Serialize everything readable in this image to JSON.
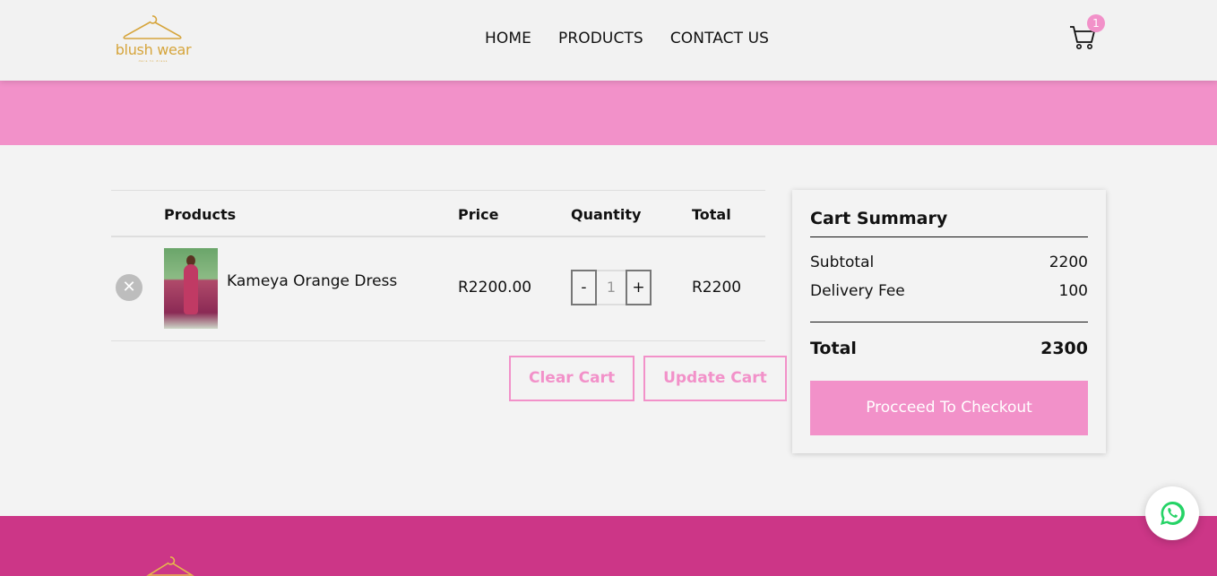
{
  "brand": {
    "logo_text": "blush wear",
    "logo_tagline": "dare to dress"
  },
  "nav": {
    "items": [
      "HOME",
      "PRODUCTS",
      "CONTACT US"
    ]
  },
  "cart": {
    "badge_count": "1"
  },
  "table": {
    "headers": {
      "products": "Products",
      "price": "Price",
      "quantity": "Quantity",
      "total": "Total"
    },
    "rows": [
      {
        "name": "Kameya Orange Dress",
        "price": "R2200.00",
        "quantity": "1",
        "total": "R2200",
        "decrement": "-",
        "increment": "+"
      }
    ]
  },
  "actions": {
    "clear": "Clear Cart",
    "update": "Update Cart"
  },
  "summary": {
    "title": "Cart Summary",
    "subtotal_label": "Subtotal",
    "subtotal_value": "2200",
    "delivery_label": "Delivery Fee",
    "delivery_value": "100",
    "total_label": "Total",
    "total_value": "2300",
    "checkout_label": "Procceed To Checkout"
  },
  "colors": {
    "accent": "#f291c9",
    "footer": "#cc3687",
    "gold": "#d6a53c",
    "whatsapp": "#25d366"
  }
}
